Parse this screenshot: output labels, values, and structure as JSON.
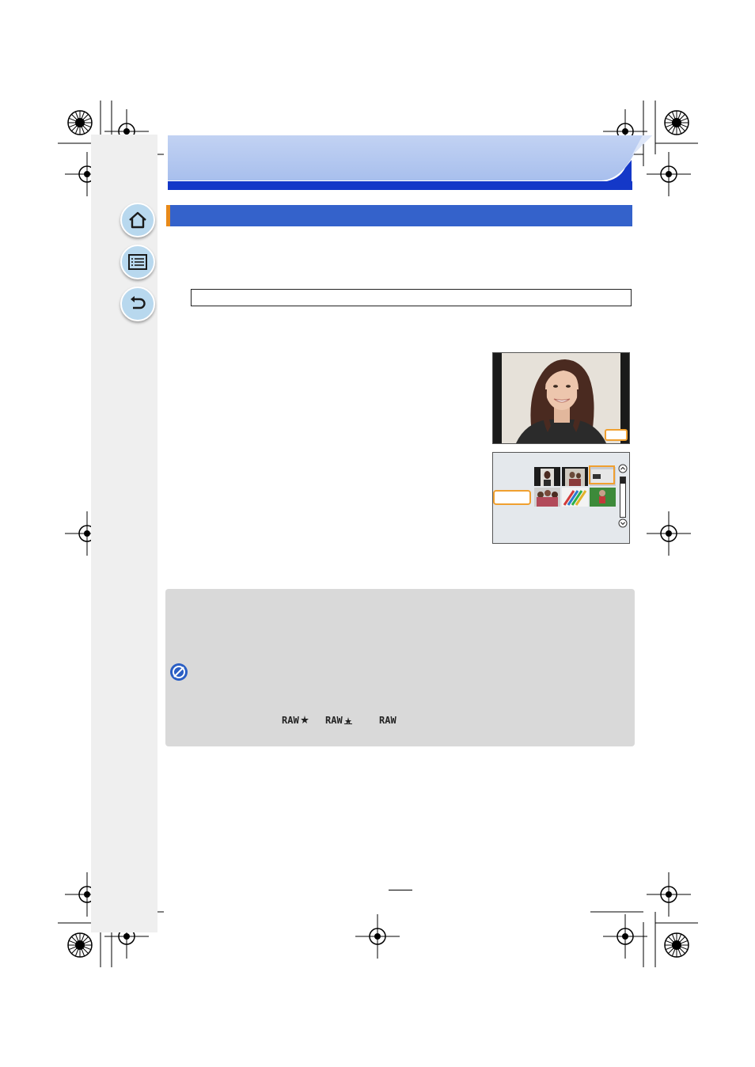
{
  "document": {
    "chapter_title": "",
    "section_title": "",
    "menu_path": "",
    "page_number": "",
    "body_text": []
  },
  "nav": {
    "home_icon": "home-icon",
    "contents_icon": "list-icon",
    "back_icon": "back-arrow-icon"
  },
  "note_box": {
    "prohibited_icon": "not-available-icon",
    "raw_badges": [
      "RAW",
      "RAW",
      "RAW"
    ]
  },
  "colors": {
    "chapter_banner": "#b3c7ef",
    "chapter_rule": "#1438c8",
    "section_bar": "#3462cb",
    "section_accent": "#e88a1a",
    "highlight_frame": "#f0a030",
    "sidebar": "#efefef",
    "note_background": "#d9d9d9"
  }
}
